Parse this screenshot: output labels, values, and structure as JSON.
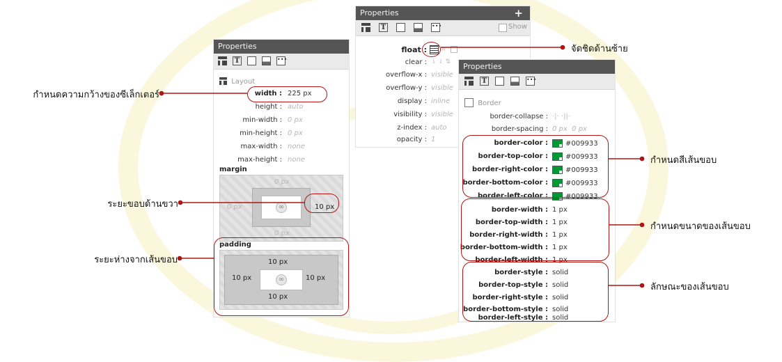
{
  "layout_panel": {
    "title": "Properties",
    "section_label": "Layout",
    "rows": [
      {
        "label": "width :",
        "value": "225 px"
      },
      {
        "label": "height :",
        "value": "auto"
      },
      {
        "label": "min-width :",
        "value": "0 px"
      },
      {
        "label": "min-height :",
        "value": "0 px"
      },
      {
        "label": "max-width :",
        "value": "none"
      },
      {
        "label": "max-height :",
        "value": "none"
      }
    ],
    "margin": {
      "label": "margin",
      "top": "0 px",
      "right": "10 px",
      "bottom": "0 px",
      "left": "0 px"
    },
    "padding": {
      "label": "padding",
      "top": "10 px",
      "right": "10 px",
      "bottom": "10 px",
      "left": "10 px"
    }
  },
  "float_panel": {
    "title": "Properties",
    "show_label": "Show",
    "rows": [
      {
        "label": "float :",
        "value": ""
      },
      {
        "label": "clear :",
        "value": ""
      },
      {
        "label": "overflow-x :",
        "value": "visible"
      },
      {
        "label": "overflow-y :",
        "value": "visible"
      },
      {
        "label": "display :",
        "value": "inline"
      },
      {
        "label": "visibility :",
        "value": "visible"
      },
      {
        "label": "z-index :",
        "value": "auto"
      },
      {
        "label": "opacity :",
        "value": "1"
      }
    ]
  },
  "border_panel": {
    "title": "Properties",
    "section_label": "Border",
    "plain_rows": [
      {
        "label": "border-collapse :",
        "value": ""
      },
      {
        "label": "border-spacing :",
        "value": "0 px  0 px"
      }
    ],
    "color_rows": [
      {
        "label": "border-color :",
        "value": "#009933"
      },
      {
        "label": "border-top-color :",
        "value": "#009933"
      },
      {
        "label": "border-right-color :",
        "value": "#009933"
      },
      {
        "label": "border-bottom-color :",
        "value": "#009933"
      },
      {
        "label": "border-left-color :",
        "value": "#009933"
      }
    ],
    "width_rows": [
      {
        "label": "border-width :",
        "value": "1 px"
      },
      {
        "label": "border-top-width :",
        "value": "1 px"
      },
      {
        "label": "border-right-width :",
        "value": "1 px"
      },
      {
        "label": "border-bottom-width :",
        "value": "1 px"
      },
      {
        "label": "border-left-width :",
        "value": "1 px"
      }
    ],
    "style_rows": [
      {
        "label": "border-style :",
        "value": "solid"
      },
      {
        "label": "border-top-style :",
        "value": "solid"
      },
      {
        "label": "border-right-style :",
        "value": "solid"
      },
      {
        "label": "border-bottom-style :",
        "value": "solid"
      },
      {
        "label": "border-left-style :",
        "value": "solid"
      }
    ]
  },
  "callouts": {
    "width": "กำหนดความกว้างของซีเล็กเตอร์",
    "margin_right": "ระยะขอบด้านขวา",
    "padding": "ระยะห่างจากเส้นขอบ",
    "float_left": "จัดชิดด้านซ้าย",
    "border_color": "กำหนดสีเส้นขอบ",
    "border_width": "กำหนดขนาดของเส้นขอบ",
    "border_style": "ลักษณะของเส้นขอบ"
  },
  "colors": {
    "accent": "#b01515",
    "swatch": "#009933",
    "titlebar": "#555555"
  }
}
